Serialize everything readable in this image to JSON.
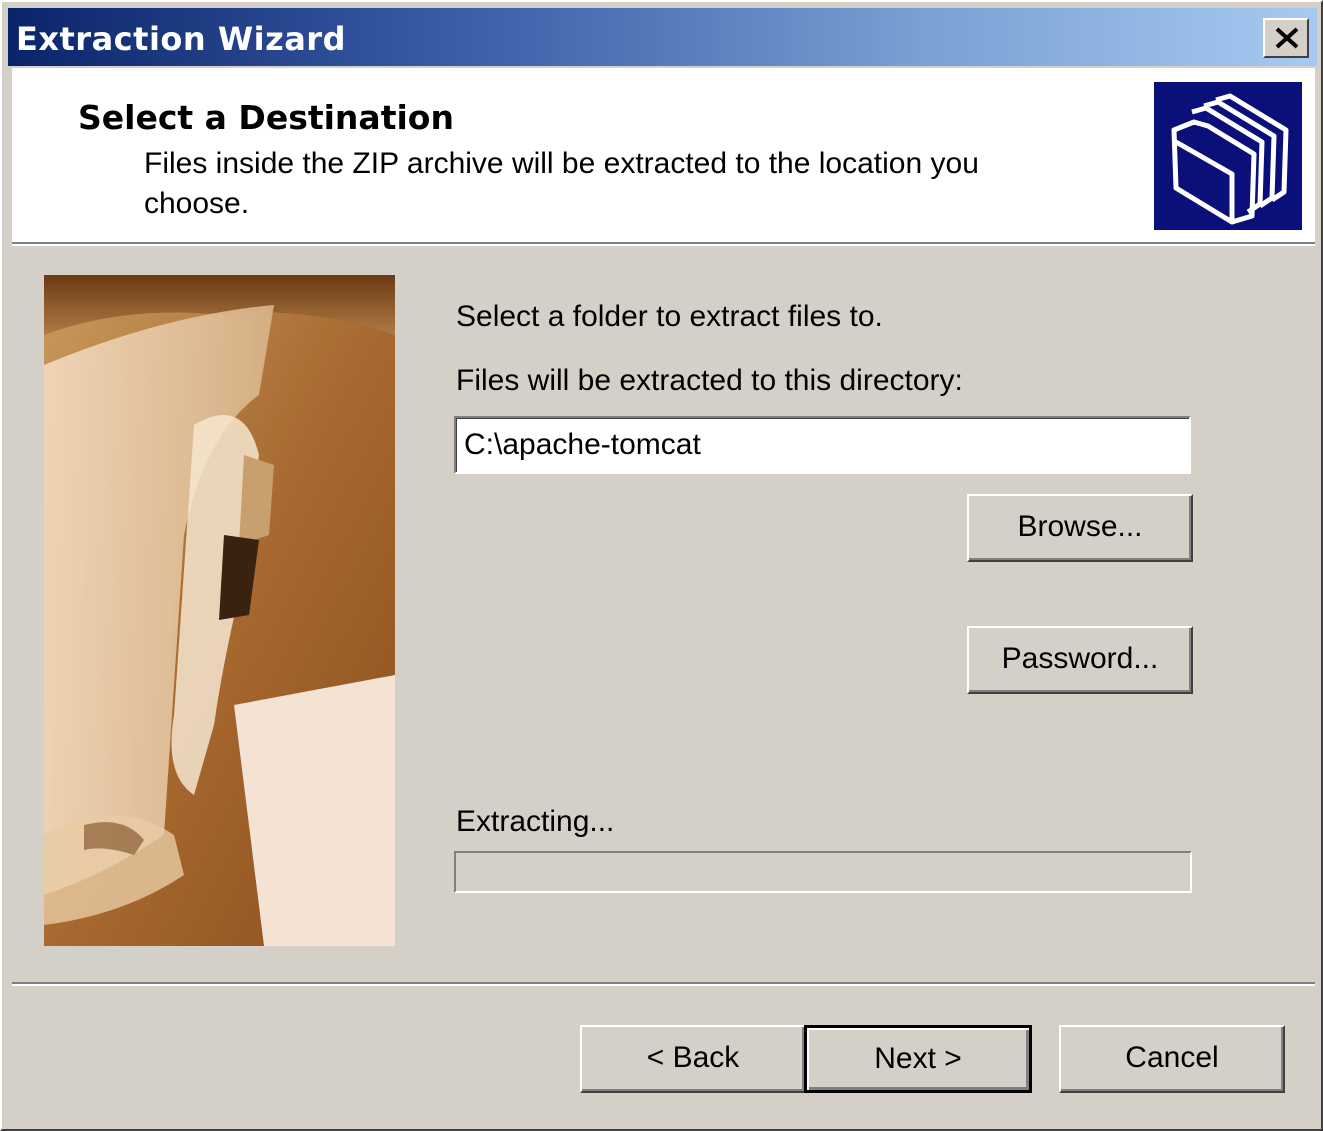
{
  "window": {
    "title": "Extraction Wizard"
  },
  "header": {
    "title": "Select a Destination",
    "description_line1": "Files inside the ZIP archive will be extracted to the location you",
    "description_line2": "choose.",
    "icon": "folders-icon"
  },
  "main": {
    "instruction": "Select a folder to extract files to.",
    "directory_label": "Files will be extracted to this directory:",
    "directory_value": "C:\\apache-tomcat",
    "browse_label": "Browse...",
    "password_label": "Password...",
    "progress_label": "Extracting...",
    "progress_value": 0
  },
  "footer": {
    "back_label": "< Back",
    "next_label": "Next >",
    "cancel_label": "Cancel"
  },
  "colors": {
    "titlebar_start": "#0a246a",
    "titlebar_end": "#a6caf0",
    "face": "#d4d0c8",
    "icon_bg": "#0a0f7a"
  }
}
